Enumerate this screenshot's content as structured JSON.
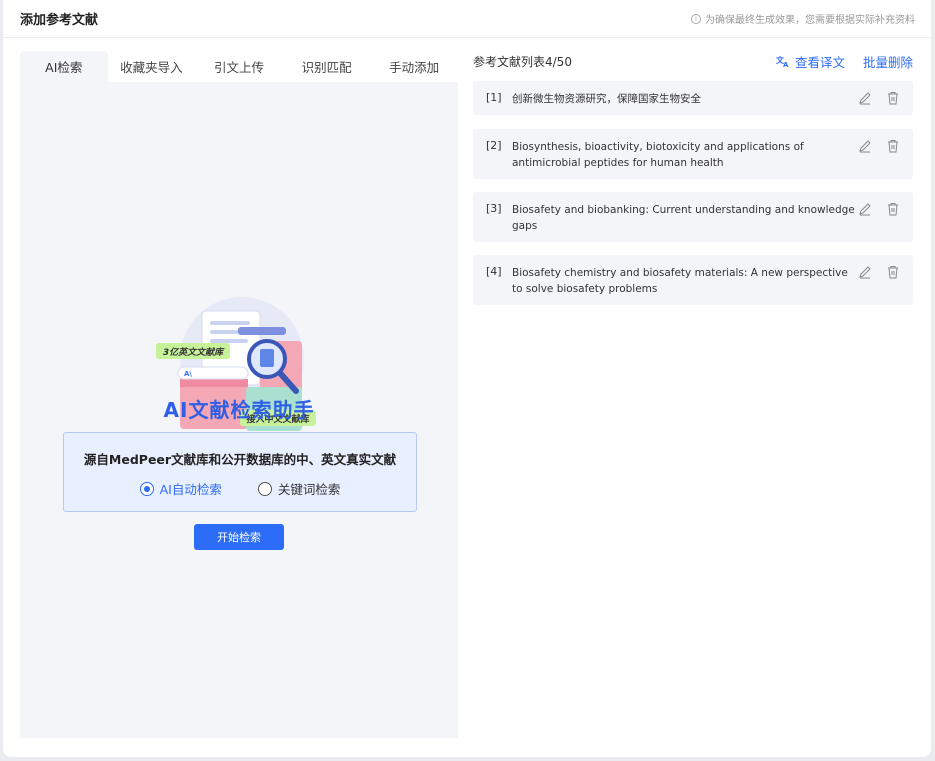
{
  "header": {
    "title": "添加参考文献",
    "tip": "为确保最终生成效果，您需要根据实际补充资料"
  },
  "tabs": [
    {
      "label": "AI检索"
    },
    {
      "label": "收藏夹导入"
    },
    {
      "label": "引文上传"
    },
    {
      "label": "识别匹配"
    },
    {
      "label": "手动添加"
    }
  ],
  "illustration": {
    "badge_en": "3亿英文文献库",
    "badge_cn": "接入中文文献库",
    "title": "AI文献检索助手"
  },
  "search_box": {
    "description": "源自MedPeer文献库和公开数据库的中、英文真实文献",
    "option_auto": "AI自动检索",
    "option_keyword": "关键词检索",
    "selected": "auto"
  },
  "start_button": "开始检索",
  "reference_list": {
    "title": "参考文献列表4/50",
    "view_translation": "查看译文",
    "batch_delete": "批量删除",
    "items": [
      {
        "num": "[1]",
        "text": "创新微生物资源研究，保障国家生物安全"
      },
      {
        "num": "[2]",
        "text": "Biosynthesis, bioactivity, biotoxicity and applications of antimicrobial peptides for human health"
      },
      {
        "num": "[3]",
        "text": "Biosafety and biobanking: Current understanding and knowledge gaps"
      },
      {
        "num": "[4]",
        "text": "Biosafety chemistry and biosafety materials: A new perspective to solve biosafety problems"
      }
    ]
  },
  "colors": {
    "accent": "#2d6cf6",
    "panel_bg": "#f4f5f9",
    "info_bg": "#e8efff"
  }
}
